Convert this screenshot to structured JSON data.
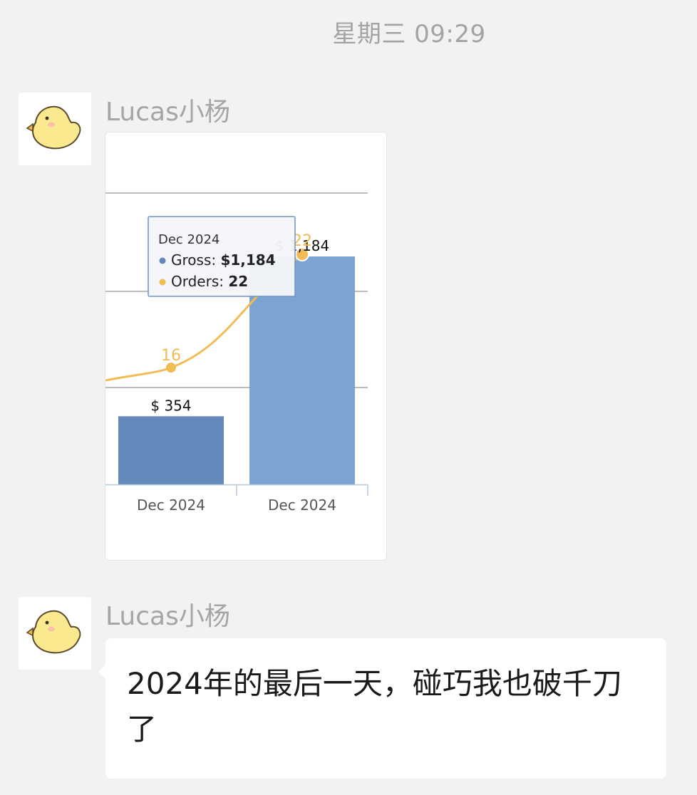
{
  "timestamp": "星期三 09:29",
  "messages": [
    {
      "sender": "Lucas小杨",
      "type": "chart"
    },
    {
      "sender": "Lucas小杨",
      "type": "text",
      "text": "2024年的最后一天，碰巧我也破千刀了"
    }
  ],
  "colors": {
    "background": "#f2f2f2",
    "bar_gross_1": "#6389bb",
    "bar_gross_2": "#7ba4d3",
    "line_orders": "#f2bc55",
    "avatar_chick": "#fbe98f"
  },
  "avatar_icon": "chick-icon",
  "chart_data": {
    "type": "bar",
    "categories": [
      "Dec 2024",
      "Dec 2024"
    ],
    "series": [
      {
        "name": "Gross",
        "type": "bar",
        "values": [
          354,
          1184
        ],
        "labels": [
          "$ 354",
          "$ 1,184"
        ]
      },
      {
        "name": "Orders",
        "type": "line",
        "values": [
          16,
          22
        ],
        "labels": [
          "16",
          "22"
        ]
      }
    ],
    "ylim": [
      0,
      1500
    ],
    "grid": true,
    "tooltip": {
      "title": "Dec 2024",
      "rows": [
        {
          "name": "Gross",
          "value": "$1,184"
        },
        {
          "name": "Orders",
          "value": "22"
        }
      ]
    }
  }
}
